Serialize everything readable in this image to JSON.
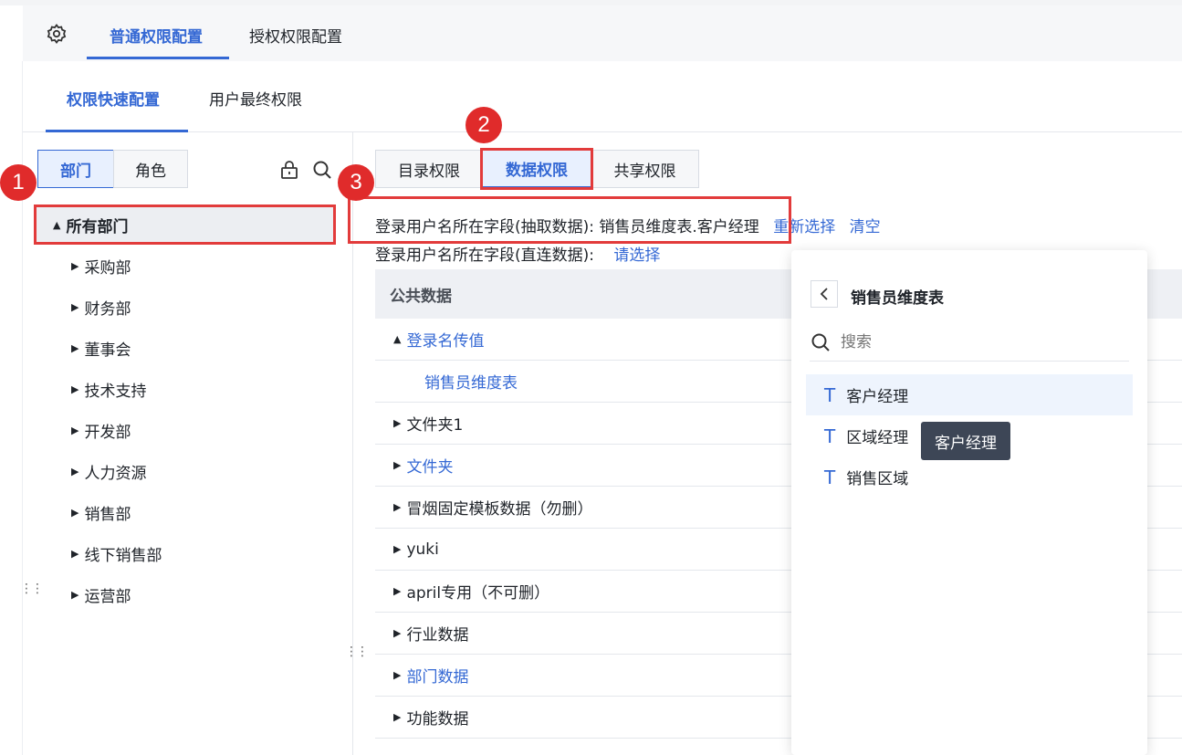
{
  "top_tabs": [
    "普通权限配置",
    "授权权限配置"
  ],
  "sub_tabs": [
    "权限快速配置",
    "用户最终权限"
  ],
  "left_panel": {
    "segments": [
      "部门",
      "角色"
    ],
    "root": "所有部门",
    "departments": [
      "采购部",
      "财务部",
      "董事会",
      "技术支持",
      "开发部",
      "人力资源",
      "销售部",
      "线下销售部",
      "运营部"
    ]
  },
  "right_tabs": [
    "目录权限",
    "数据权限",
    "共享权限"
  ],
  "field_extract": {
    "label": "登录用户名所在字段(抽取数据): 销售员维度表.客户经理",
    "reselect": "重新选择",
    "clear": "清空"
  },
  "field_direct": {
    "label": "登录用户名所在字段(直连数据):",
    "choose": "请选择"
  },
  "table": {
    "header": "公共数据",
    "rows": [
      {
        "label": "登录名传值",
        "arrow": "▲",
        "indent": 0,
        "blue": true
      },
      {
        "label": "销售员维度表",
        "arrow": "",
        "indent": 1,
        "blue": true
      },
      {
        "label": "文件夹1",
        "arrow": "▶",
        "indent": 0,
        "blue": false
      },
      {
        "label": "文件夹",
        "arrow": "▶",
        "indent": 0,
        "blue": true
      },
      {
        "label": "冒烟固定模板数据（勿删）",
        "arrow": "▶",
        "indent": 0,
        "blue": false
      },
      {
        "label": "yuki",
        "arrow": "▶",
        "indent": 0,
        "blue": false
      },
      {
        "label": "april专用（不可删）",
        "arrow": "▶",
        "indent": 0,
        "blue": false
      },
      {
        "label": "行业数据",
        "arrow": "▶",
        "indent": 0,
        "blue": false
      },
      {
        "label": "部门数据",
        "arrow": "▶",
        "indent": 0,
        "blue": true
      },
      {
        "label": "功能数据",
        "arrow": "▶",
        "indent": 0,
        "blue": false
      }
    ]
  },
  "popup": {
    "title": "销售员维度表",
    "search_placeholder": "搜索",
    "items": [
      "客户经理",
      "区域经理",
      "销售区域"
    ],
    "tooltip": "客户经理"
  },
  "badges": [
    "1",
    "2",
    "3"
  ],
  "colors": {
    "accent": "#3468d4",
    "annotation": "#e23b3b"
  }
}
